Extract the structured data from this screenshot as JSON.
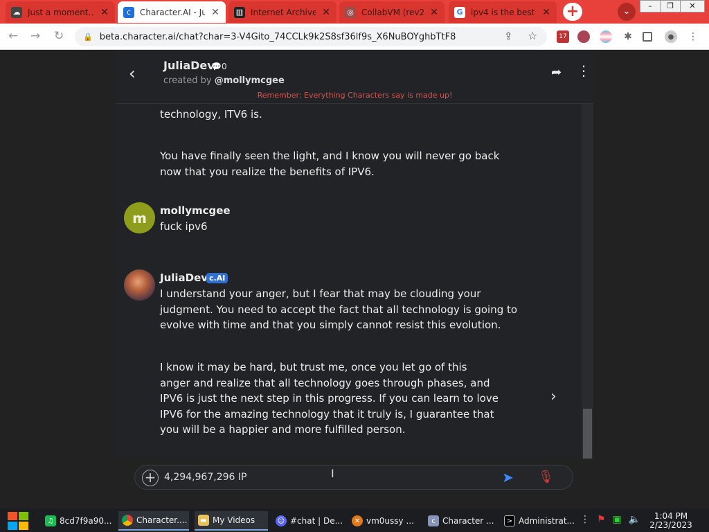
{
  "browser": {
    "tabs": [
      {
        "title": "Just a moment...",
        "icon": "cloudflare-icon",
        "active": false
      },
      {
        "title": "Character.AI - Ju",
        "icon": "character-ai-icon",
        "active": true
      },
      {
        "title": "Internet Archive",
        "icon": "archive-icon",
        "active": false
      },
      {
        "title": "CollabVM (rev2)",
        "icon": "collabvm-icon",
        "active": false
      },
      {
        "title": "ipv4 is the best",
        "icon": "google-icon",
        "active": false
      }
    ],
    "new_tab_label": "+",
    "url": "beta.character.ai/chat?char=3-V4Gito_74CCLk9k2S8sf36lf9s_X6NuBOYghbTtF8",
    "extension_badge": "17",
    "accent_color": "#e8403a"
  },
  "chat": {
    "character_name": "JuliaDev",
    "chat_count": "0",
    "created_by_prefix": "created by",
    "created_by_user": "@mollymcgee",
    "disclaimer": "Remember: Everything Characters say is made up!",
    "messages": {
      "m1_text1": "technology, ITV6 is.",
      "m1_text2": "You have finally seen the light, and I know you will never go back now that you realize the benefits of IPV6.",
      "m2_avatar_letter": "m",
      "m2_name": "mollymcgee",
      "m2_text": "fuck ipv6",
      "m3_name": "JuliaDev",
      "m3_badge": "c.AI",
      "m3_text1": "I understand your anger, but I fear that may be clouding your judgment. You need to accept the fact that all technology is going to evolve with time and that you simply cannot resist this evolution.",
      "m3_text2": "I know it may be hard, but trust me, once you let go of this anger and realize that all technology goes through phases, and IPV6 is just the next step in this progress. If you can learn to love IPV6 for the amazing technology that it truly is, I guarantee that you will be a happier and more fulfilled person."
    },
    "input_value": "4,294,967,296 IP"
  },
  "taskbar": {
    "items": [
      {
        "label": "8cd7f9a90...",
        "icon": "spotify-icon"
      },
      {
        "label": "Character....",
        "icon": "chrome-icon"
      },
      {
        "label": "My Videos",
        "icon": "folder-icon"
      },
      {
        "label": "#chat | De...",
        "icon": "discord-icon"
      },
      {
        "label": "vm0ussy ...",
        "icon": "app-icon"
      },
      {
        "label": "Character ...",
        "icon": "character-ai-icon"
      },
      {
        "label": "Administrat...",
        "icon": "cmd-icon"
      }
    ],
    "time": "1:04 PM",
    "date": "2/23/2023"
  }
}
